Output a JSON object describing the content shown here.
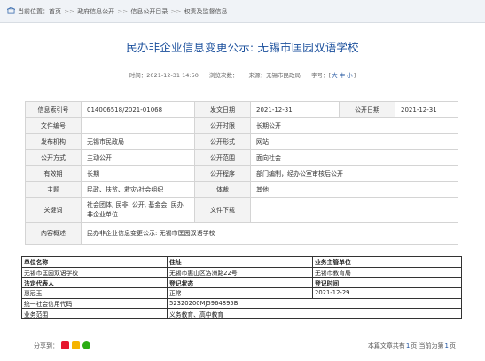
{
  "breadcrumb": {
    "label": "当前位置：",
    "items": [
      "首页",
      "政府信息公开",
      "信息公开目录",
      "权责及监督信息"
    ]
  },
  "title": "民办非企业信息变更公示: 无锡市匡园双语学校",
  "meta": {
    "time_label": "时间：",
    "time": "2021-12-31 14:50",
    "views_label": "浏览次数：",
    "views": "",
    "source_label": "来源：",
    "source": "无锡市民政局",
    "fontsize_label": "字号：[",
    "fontsize_options": [
      "大",
      "中",
      "小"
    ],
    "fontsize_close": "]"
  },
  "info": {
    "index_label": "信息索引号",
    "index": "014006518/2021-01068",
    "date_label": "发文日期",
    "date": "2021-12-31",
    "pubdate_label": "公开日期",
    "pubdate": "2021-12-31",
    "docno_label": "文件编号",
    "docno": "",
    "pubtime_label": "公开时限",
    "pubtime": "长期公开",
    "org_label": "发布机构",
    "org": "无锡市民政局",
    "form_label": "公开形式",
    "form": "网站",
    "method_label": "公开方式",
    "method": "主动公开",
    "scope_label": "公开范围",
    "scope": "面向社会",
    "validity_label": "有效期",
    "validity": "长期",
    "procedure_label": "公开程序",
    "procedure": "部门编制，经办公室审核后公开",
    "topic_label": "主题",
    "topic": "民政、扶贫、救灾\\社会组织",
    "genre_label": "体裁",
    "genre": "其他",
    "keywords_label": "关键词",
    "keywords": "社会团体, 民非, 公开, 基金会, 民办非企业单位",
    "download_label": "文件下载",
    "download": "",
    "summary_label": "内容概述",
    "summary": "民办非企业信息变更公示: 无锡市匡园双语学校"
  },
  "legal": {
    "r1": [
      "单位名称",
      "住址",
      "业务主管单位"
    ],
    "r2": [
      "无锡市匡园双语学校",
      "无锡市惠山区洛洲路22号",
      "无锡市教育局"
    ],
    "r3": [
      "法定代表人",
      "登记状态",
      "登记时间"
    ],
    "r4": [
      "惠冠玉",
      "正常",
      "2021-12-29"
    ],
    "r5": [
      "统一社会信用代码",
      "52320200MJ5964895B"
    ],
    "r6": [
      "业务范围",
      "义务教育、高中教育"
    ]
  },
  "footer": {
    "share_label": "分享到：",
    "share_icons": [
      "weibo-icon",
      "qzone-icon",
      "wechat-icon"
    ],
    "pager_pre": "本篇文章共有",
    "pager_total": "1",
    "pager_mid": "页 当前为第",
    "pager_current": "1",
    "pager_post": "页"
  },
  "colors": {
    "title": "#1a4f9c",
    "label_bg": "#f3f3f3",
    "crumb_bg": "#f0f3f7"
  }
}
